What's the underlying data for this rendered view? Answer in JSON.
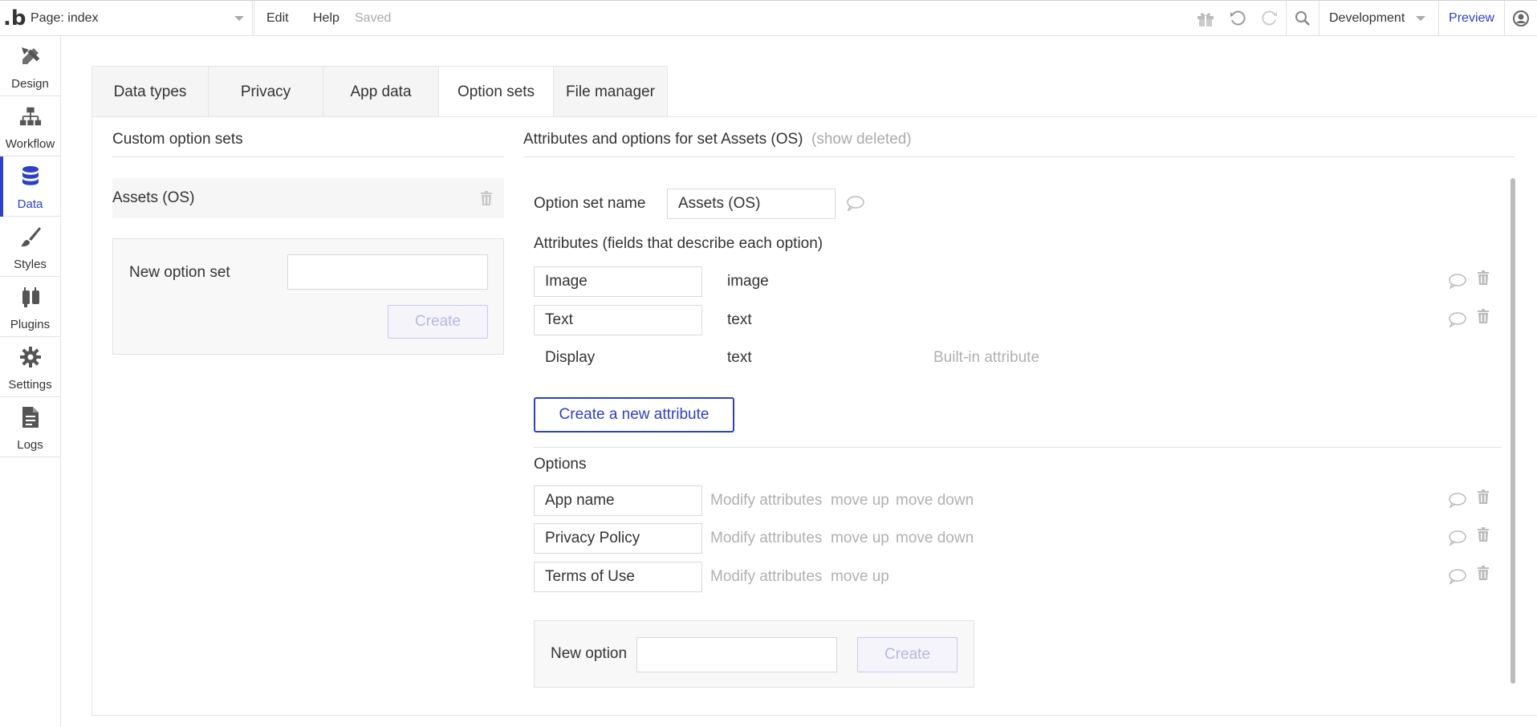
{
  "topbar": {
    "logo": ".b",
    "page_selector": "Page: index",
    "menu": {
      "edit": "Edit",
      "help": "Help",
      "status": "Saved"
    },
    "environment": "Development",
    "preview": "Preview"
  },
  "sidebar": {
    "items": [
      {
        "label": "Design",
        "icon": "design-icon"
      },
      {
        "label": "Workflow",
        "icon": "workflow-icon"
      },
      {
        "label": "Data",
        "icon": "database-icon",
        "active": true
      },
      {
        "label": "Styles",
        "icon": "brush-icon"
      },
      {
        "label": "Plugins",
        "icon": "plug-icon"
      },
      {
        "label": "Settings",
        "icon": "gear-icon"
      },
      {
        "label": "Logs",
        "icon": "document-icon"
      }
    ]
  },
  "tabs": [
    {
      "label": "Data types"
    },
    {
      "label": "Privacy"
    },
    {
      "label": "App data"
    },
    {
      "label": "Option sets",
      "active": true
    },
    {
      "label": "File manager"
    }
  ],
  "left_panel": {
    "title": "Custom option sets",
    "sets": [
      {
        "name": "Assets (OS)"
      }
    ],
    "new_set_label": "New option set",
    "new_set_value": "",
    "create_label": "Create"
  },
  "right_panel": {
    "title": "Attributes and options for set Assets (OS)",
    "show_deleted": "(show deleted)",
    "option_set_name_label": "Option set name",
    "option_set_name_value": "Assets (OS)",
    "attributes_title": "Attributes (fields that describe each option)",
    "attributes": [
      {
        "name": "Image",
        "type": "image"
      },
      {
        "name": "Text",
        "type": "text"
      },
      {
        "name": "Display",
        "type": "text",
        "note": "Built-in attribute"
      }
    ],
    "create_attribute_label": "Create a new attribute",
    "options_title": "Options",
    "options": [
      {
        "name": "App name",
        "modify": "Modify attributes",
        "up": "move up",
        "down": "move down"
      },
      {
        "name": "Privacy Policy",
        "modify": "Modify attributes",
        "up": "move up",
        "down": "move down"
      },
      {
        "name": "Terms of Use",
        "modify": "Modify attributes",
        "up": "move up"
      }
    ],
    "new_option_label": "New option",
    "new_option_value": "",
    "create_option_label": "Create"
  },
  "colors": {
    "accent": "#2c41c8",
    "muted_text": "#aaaaaa",
    "border": "#e2e2e2"
  }
}
